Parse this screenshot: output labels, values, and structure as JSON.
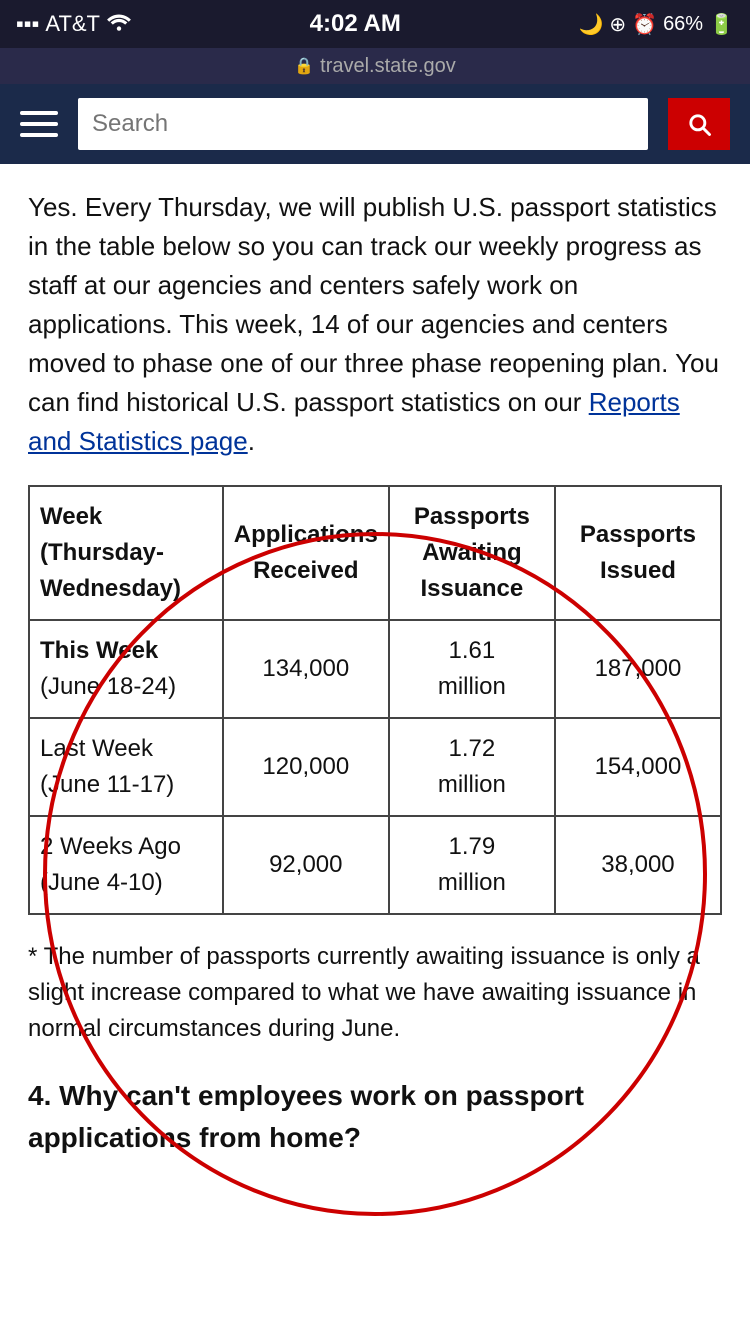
{
  "statusBar": {
    "carrier": "AT&T",
    "time": "4:02 AM",
    "battery": "66%",
    "signalBars": "▪▪▪",
    "wifiIcon": "wifi"
  },
  "urlBar": {
    "url": "travel.state.gov",
    "lockIcon": "🔒"
  },
  "nav": {
    "searchPlaceholder": "Search",
    "menuIcon": "hamburger",
    "searchIcon": "search"
  },
  "content": {
    "introParagraph": "Yes. Every Thursday, we will publish U.S. passport statistics in the table below so you can track our weekly progress as staff at our agencies and centers safely work on applications. This week, 14 of our agencies and centers moved to phase one of our three phase reopening plan. You can find historical U.S. passport statistics on our ",
    "reportsLinkText": "Reports and Statistics page",
    "introPeriod": ".",
    "tableHeaders": {
      "week": "Week (Thursday-Wednesday)",
      "applications": "Applications Received",
      "passportsAwaiting": "Passports Awaiting Issuance",
      "passportsIssued": "Passports Issued"
    },
    "tableRows": [
      {
        "week": "This Week (June 18-24)",
        "applications": "134,000",
        "passportsAwaiting": "1.61 million",
        "passportsIssued": "187,000",
        "isThisWeek": true
      },
      {
        "week": "Last Week (June 11-17)",
        "applications": "120,000",
        "passportsAwaiting": "1.72 million",
        "passportsIssued": "154,000",
        "isThisWeek": false
      },
      {
        "week": "2 Weeks Ago (June 4-10)",
        "applications": "92,000",
        "passportsAwaiting": "1.79 million",
        "passportsIssued": "38,000",
        "isThisWeek": false
      }
    ],
    "footnote": "* The number of passports currently awaiting issuance is only a slight increase compared to what we have awaiting issuance in normal circumstances during June.",
    "nextSectionHeading": "4. Why can't employees work on passport applications from home?"
  }
}
